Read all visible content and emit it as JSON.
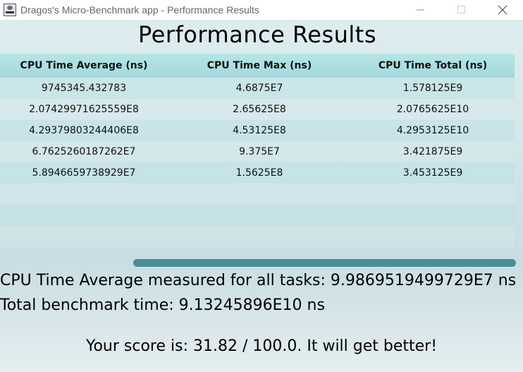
{
  "window": {
    "title": "Dragos's Micro-Benchmark app - Performance Results"
  },
  "page": {
    "title": "Performance Results"
  },
  "table": {
    "headers": [
      "CPU Time Average (ns)",
      "CPU Time Max (ns)",
      "CPU Time Total (ns)"
    ],
    "rows": [
      [
        "9745345.432783",
        "4.6875E7",
        "1.578125E9"
      ],
      [
        "2.07429971625559E8",
        "2.65625E8",
        "2.0765625E10"
      ],
      [
        "4.29379803244406E8",
        "4.53125E8",
        "4.2953125E10"
      ],
      [
        "6.7625260187262E7",
        "9.375E7",
        "3.421875E9"
      ],
      [
        "5.8946659738929E7",
        "1.5625E8",
        "3.453125E9"
      ]
    ]
  },
  "summary": {
    "avg_line": "CPU Time Average measured for all tasks: 9.9869519499729E7 ns",
    "total_line": "Total benchmark time: 9.13245896E10 ns",
    "score_line": "Your score is: 31.82 / 100.0. It will get better!"
  },
  "colors": {
    "header": "#a4d8dc",
    "scrollbar": "#4a8e94"
  },
  "icons": {
    "app": "app-logo-icon",
    "minimize": "minimize-icon",
    "maximize": "maximize-icon",
    "close": "close-icon"
  }
}
